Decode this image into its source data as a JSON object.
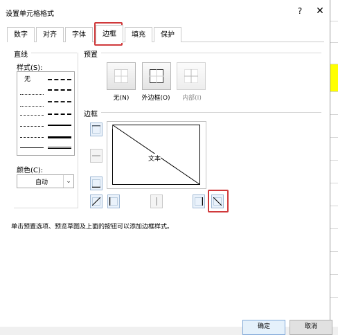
{
  "dialog": {
    "title": "设置单元格格式",
    "help": "?",
    "close": "✕"
  },
  "tabs": [
    {
      "label": "数字"
    },
    {
      "label": "对齐"
    },
    {
      "label": "字体"
    },
    {
      "label": "边框",
      "active": true
    },
    {
      "label": "填充"
    },
    {
      "label": "保护"
    }
  ],
  "line": {
    "group_title": "直线",
    "style_label": "样式(S):",
    "style_none": "无",
    "color_label": "颜色(C):",
    "color_value": "自动"
  },
  "presets": {
    "group_title": "预置",
    "none": "无(N)",
    "outline": "外边框(O)",
    "inside": "内部(I)"
  },
  "border": {
    "group_title": "边框",
    "preview_text": "文本"
  },
  "hint": "单击预置选项、预览草图及上面的按钮可以添加边框样式。",
  "buttons": {
    "ok": "确定",
    "cancel": "取消"
  },
  "colors": {
    "highlight": "#d0393b",
    "excel_yellow": "#ffff00"
  }
}
